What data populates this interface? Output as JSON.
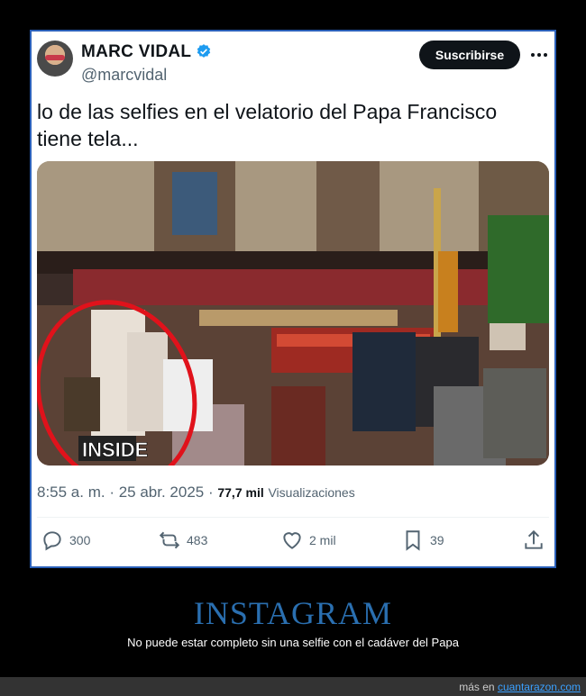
{
  "tweet": {
    "author_name": "MARC VIDAL",
    "handle": "@marcvidal",
    "subscribe_label": "Suscribirse",
    "text_line1": "lo de las selfies en el velatorio del Papa Francisco",
    "text_line2": "tiene tela...",
    "timestamp": "8:55 a. m. · 25 abr. 2025 ·",
    "views_count": "77,7 mil",
    "views_label": "Visualizaciones",
    "media_watermark": "INSIDE"
  },
  "actions": {
    "replies": "300",
    "reposts": "483",
    "likes": "2 mil",
    "bookmarks": "39"
  },
  "footer": {
    "title": "INSTAGRAM",
    "caption": "No puede estar completo sin una selfie con el cadáver del Papa",
    "credit_prefix": "más en",
    "credit_site": "cuantarazon.com"
  },
  "colors": {
    "verified": "#1d9bf0",
    "border": "#2a5fb8",
    "highlight_circle": "#e0121b",
    "footer_title": "#2a6fb0",
    "credit_link": "#3aa0ff"
  }
}
